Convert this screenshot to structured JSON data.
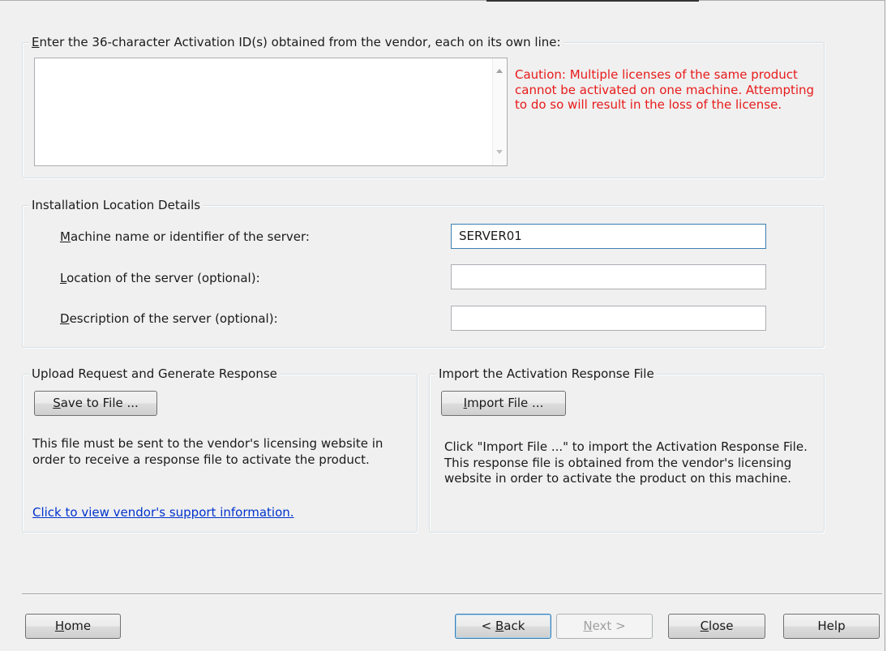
{
  "activation_group": {
    "legend_u": "E",
    "legend_rest": "nter the 36-character Activation ID(s) obtained from the vendor, each on its own line:",
    "textarea_value": "",
    "caution": "Caution: Multiple licenses of the same product cannot be activated on one machine. Attempting to do so will result in the loss of the license."
  },
  "installation_group": {
    "legend": "Installation Location Details",
    "machine": {
      "label_u": "M",
      "label_rest": "achine name or identifier of the server:",
      "value": "SERVER01"
    },
    "location": {
      "label_u": "L",
      "label_rest": "ocation of the server (optional):",
      "value": ""
    },
    "description": {
      "label_u": "D",
      "label_rest": "escription of the server (optional):",
      "value": ""
    }
  },
  "upload_group": {
    "legend": "Upload Request and Generate Response",
    "save_button_u": "S",
    "save_button_rest": "ave to File ...",
    "description": "This file must be sent to the vendor's licensing website in order to receive a response file to activate the product.",
    "support_link": "Click to view vendor's support information."
  },
  "import_group": {
    "legend": "Import the Activation Response File",
    "import_button_u": "I",
    "import_button_rest": "mport File ...",
    "description": "Click \"Import File ...\" to import the Activation Response File.  This response file is obtained from the vendor's licensing website in order to activate the product on this machine."
  },
  "footer": {
    "home_u": "H",
    "home_rest": "ome",
    "back_pre": "< ",
    "back_u": "B",
    "back_rest": "ack",
    "next_u": "N",
    "next_rest": "ext >",
    "close_u": "C",
    "close_rest": "lose",
    "help": "Help"
  },
  "colors": {
    "caution_text": "#e81a1a",
    "link": "#0033cc",
    "focus_border": "#3c7fb1"
  }
}
